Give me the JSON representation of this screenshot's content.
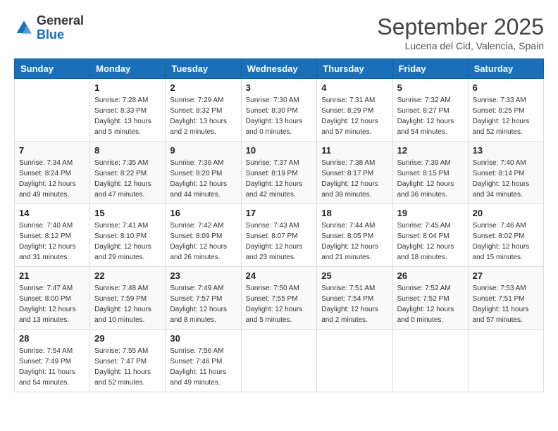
{
  "header": {
    "logo": {
      "general": "General",
      "blue": "Blue"
    },
    "title": "September 2025",
    "location": "Lucena del Cid, Valencia, Spain"
  },
  "weekdays": [
    "Sunday",
    "Monday",
    "Tuesday",
    "Wednesday",
    "Thursday",
    "Friday",
    "Saturday"
  ],
  "weeks": [
    [
      {
        "day": "",
        "sunrise": "",
        "sunset": "",
        "daylight": ""
      },
      {
        "day": "1",
        "sunrise": "Sunrise: 7:28 AM",
        "sunset": "Sunset: 8:33 PM",
        "daylight": "Daylight: 13 hours and 5 minutes."
      },
      {
        "day": "2",
        "sunrise": "Sunrise: 7:29 AM",
        "sunset": "Sunset: 8:32 PM",
        "daylight": "Daylight: 13 hours and 2 minutes."
      },
      {
        "day": "3",
        "sunrise": "Sunrise: 7:30 AM",
        "sunset": "Sunset: 8:30 PM",
        "daylight": "Daylight: 13 hours and 0 minutes."
      },
      {
        "day": "4",
        "sunrise": "Sunrise: 7:31 AM",
        "sunset": "Sunset: 8:29 PM",
        "daylight": "Daylight: 12 hours and 57 minutes."
      },
      {
        "day": "5",
        "sunrise": "Sunrise: 7:32 AM",
        "sunset": "Sunset: 8:27 PM",
        "daylight": "Daylight: 12 hours and 54 minutes."
      },
      {
        "day": "6",
        "sunrise": "Sunrise: 7:33 AM",
        "sunset": "Sunset: 8:25 PM",
        "daylight": "Daylight: 12 hours and 52 minutes."
      }
    ],
    [
      {
        "day": "7",
        "sunrise": "Sunrise: 7:34 AM",
        "sunset": "Sunset: 8:24 PM",
        "daylight": "Daylight: 12 hours and 49 minutes."
      },
      {
        "day": "8",
        "sunrise": "Sunrise: 7:35 AM",
        "sunset": "Sunset: 8:22 PM",
        "daylight": "Daylight: 12 hours and 47 minutes."
      },
      {
        "day": "9",
        "sunrise": "Sunrise: 7:36 AM",
        "sunset": "Sunset: 8:20 PM",
        "daylight": "Daylight: 12 hours and 44 minutes."
      },
      {
        "day": "10",
        "sunrise": "Sunrise: 7:37 AM",
        "sunset": "Sunset: 8:19 PM",
        "daylight": "Daylight: 12 hours and 42 minutes."
      },
      {
        "day": "11",
        "sunrise": "Sunrise: 7:38 AM",
        "sunset": "Sunset: 8:17 PM",
        "daylight": "Daylight: 12 hours and 39 minutes."
      },
      {
        "day": "12",
        "sunrise": "Sunrise: 7:39 AM",
        "sunset": "Sunset: 8:15 PM",
        "daylight": "Daylight: 12 hours and 36 minutes."
      },
      {
        "day": "13",
        "sunrise": "Sunrise: 7:40 AM",
        "sunset": "Sunset: 8:14 PM",
        "daylight": "Daylight: 12 hours and 34 minutes."
      }
    ],
    [
      {
        "day": "14",
        "sunrise": "Sunrise: 7:40 AM",
        "sunset": "Sunset: 8:12 PM",
        "daylight": "Daylight: 12 hours and 31 minutes."
      },
      {
        "day": "15",
        "sunrise": "Sunrise: 7:41 AM",
        "sunset": "Sunset: 8:10 PM",
        "daylight": "Daylight: 12 hours and 29 minutes."
      },
      {
        "day": "16",
        "sunrise": "Sunrise: 7:42 AM",
        "sunset": "Sunset: 8:09 PM",
        "daylight": "Daylight: 12 hours and 26 minutes."
      },
      {
        "day": "17",
        "sunrise": "Sunrise: 7:43 AM",
        "sunset": "Sunset: 8:07 PM",
        "daylight": "Daylight: 12 hours and 23 minutes."
      },
      {
        "day": "18",
        "sunrise": "Sunrise: 7:44 AM",
        "sunset": "Sunset: 8:05 PM",
        "daylight": "Daylight: 12 hours and 21 minutes."
      },
      {
        "day": "19",
        "sunrise": "Sunrise: 7:45 AM",
        "sunset": "Sunset: 8:04 PM",
        "daylight": "Daylight: 12 hours and 18 minutes."
      },
      {
        "day": "20",
        "sunrise": "Sunrise: 7:46 AM",
        "sunset": "Sunset: 8:02 PM",
        "daylight": "Daylight: 12 hours and 15 minutes."
      }
    ],
    [
      {
        "day": "21",
        "sunrise": "Sunrise: 7:47 AM",
        "sunset": "Sunset: 8:00 PM",
        "daylight": "Daylight: 12 hours and 13 minutes."
      },
      {
        "day": "22",
        "sunrise": "Sunrise: 7:48 AM",
        "sunset": "Sunset: 7:59 PM",
        "daylight": "Daylight: 12 hours and 10 minutes."
      },
      {
        "day": "23",
        "sunrise": "Sunrise: 7:49 AM",
        "sunset": "Sunset: 7:57 PM",
        "daylight": "Daylight: 12 hours and 8 minutes."
      },
      {
        "day": "24",
        "sunrise": "Sunrise: 7:50 AM",
        "sunset": "Sunset: 7:55 PM",
        "daylight": "Daylight: 12 hours and 5 minutes."
      },
      {
        "day": "25",
        "sunrise": "Sunrise: 7:51 AM",
        "sunset": "Sunset: 7:54 PM",
        "daylight": "Daylight: 12 hours and 2 minutes."
      },
      {
        "day": "26",
        "sunrise": "Sunrise: 7:52 AM",
        "sunset": "Sunset: 7:52 PM",
        "daylight": "Daylight: 12 hours and 0 minutes."
      },
      {
        "day": "27",
        "sunrise": "Sunrise: 7:53 AM",
        "sunset": "Sunset: 7:51 PM",
        "daylight": "Daylight: 11 hours and 57 minutes."
      }
    ],
    [
      {
        "day": "28",
        "sunrise": "Sunrise: 7:54 AM",
        "sunset": "Sunset: 7:49 PM",
        "daylight": "Daylight: 11 hours and 54 minutes."
      },
      {
        "day": "29",
        "sunrise": "Sunrise: 7:55 AM",
        "sunset": "Sunset: 7:47 PM",
        "daylight": "Daylight: 11 hours and 52 minutes."
      },
      {
        "day": "30",
        "sunrise": "Sunrise: 7:56 AM",
        "sunset": "Sunset: 7:46 PM",
        "daylight": "Daylight: 11 hours and 49 minutes."
      },
      {
        "day": "",
        "sunrise": "",
        "sunset": "",
        "daylight": ""
      },
      {
        "day": "",
        "sunrise": "",
        "sunset": "",
        "daylight": ""
      },
      {
        "day": "",
        "sunrise": "",
        "sunset": "",
        "daylight": ""
      },
      {
        "day": "",
        "sunrise": "",
        "sunset": "",
        "daylight": ""
      }
    ]
  ]
}
